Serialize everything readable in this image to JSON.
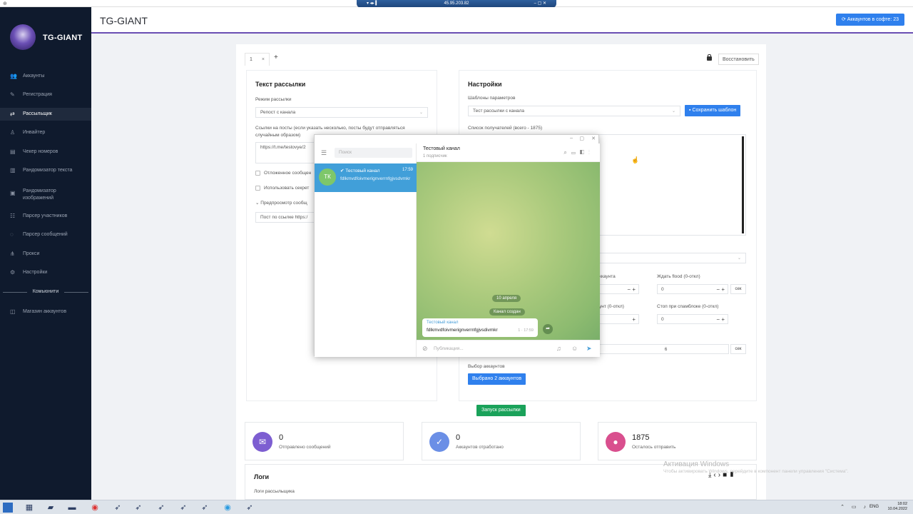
{
  "remote_bar": {
    "ip": "45.95.203.82"
  },
  "app": {
    "brand": "TG-GIANT",
    "page_title": "TG-GIANT",
    "accounts_button": "Аккаунтов в софте: 23"
  },
  "sidebar": {
    "items": [
      {
        "label": "Аккаунты",
        "icon": "users-icon"
      },
      {
        "label": "Регистрация",
        "icon": "edit-icon"
      },
      {
        "label": "Рассыльщик",
        "icon": "broadcast-icon"
      },
      {
        "label": "Инвайтер",
        "icon": "user-add-icon"
      },
      {
        "label": "Чекер номеров",
        "icon": "id-card-icon"
      },
      {
        "label": "Рандомизатор текста",
        "icon": "text-icon"
      },
      {
        "label": "Рандомизатор изображений",
        "icon": "image-icon"
      },
      {
        "label": "Парсер участников",
        "icon": "group-icon"
      },
      {
        "label": "Парсер сообщений",
        "icon": "chat-icon"
      },
      {
        "label": "Прокси",
        "icon": "network-icon"
      },
      {
        "label": "Настройки",
        "icon": "gear-icon"
      }
    ],
    "community_heading": "Комьюнити",
    "community_items": [
      {
        "label": "Магазин аккаунтов",
        "icon": "bag-icon"
      }
    ],
    "active": "Рассыльщик"
  },
  "tabs": {
    "current": "1",
    "close": "×",
    "add": "+",
    "restore": "Восстановить"
  },
  "left_card": {
    "title": "Текст рассылки",
    "mode_label": "Режим рассылки",
    "mode_value": "Репост с канала",
    "links_label": "Ссылки на посты (если указать несколько, посты будут отправляться случайным образом)",
    "links_value": "https://t.me/testovye/2",
    "opt1": "Отложенное сообщен",
    "opt2": "Использовать секрет",
    "preview_label": "Предпросмотр сообщ",
    "preview_value": "Пост по ссылке https:/"
  },
  "right_card": {
    "title": "Настройки",
    "templates_label": "Шаблоны параметров",
    "template_value": "Тест рассылки с канала",
    "save_template": "Сохранить шаблон",
    "recipients_label": "Список получателей (всего - 1875)",
    "accounts_frag": "ккаунта",
    "wait_flood_label": "Ждать flood (0-откл)",
    "wait_flood_value": "0",
    "sec": "сек",
    "count_frag": "унт (0-откл)",
    "stop_spam_label": "Стоп при спамблоке (0-откл)",
    "stop_spam_value": "0",
    "delay_value": "6",
    "select_accounts_label": "Выбор аккаунтов",
    "selected_button": "Выбрано 2 аккаунтов"
  },
  "start_button": "Запуск рассылки",
  "stats": [
    {
      "value": "0",
      "caption": "Отправлено сообщений",
      "color": "#7d5ed1",
      "icon": "mail-icon"
    },
    {
      "value": "0",
      "caption": "Аккаунтов отработано",
      "color": "#6b8fe6",
      "icon": "double-check-icon"
    },
    {
      "value": "1875",
      "caption": "Осталось отправить",
      "color": "#d94f8e",
      "icon": "people-icon"
    }
  ],
  "logs": {
    "title": "Логи",
    "subtitle": "Логи рассыльщика"
  },
  "windows_activation": {
    "line1": "Активация Windows",
    "line2": "Чтобы активировать Windows, перейдите в компонент панели управления \"Система\"."
  },
  "telegram": {
    "search_placeholder": "Поиск",
    "chat_name": "Тестовый канал",
    "chat_time": "17:59",
    "chat_preview": "fdlkmvdfoivmerignverrnfgjvsdvmkr",
    "avatar": "ТК",
    "channel_title": "Тестовый канал",
    "channel_sub": "1 подписчик",
    "date_pill": "10 апреля",
    "created_pill": "Канал создан",
    "bubble_name": "Тестовый канал",
    "bubble_text": "fdlkmvdfoivmerignverrnfgjvsdivmkr",
    "bubble_meta": "1 · 17:59",
    "composer_placeholder": "Публикация..."
  },
  "taskbar": {
    "lang": "ENG",
    "time": "18:02",
    "date": "10.04.2022"
  }
}
